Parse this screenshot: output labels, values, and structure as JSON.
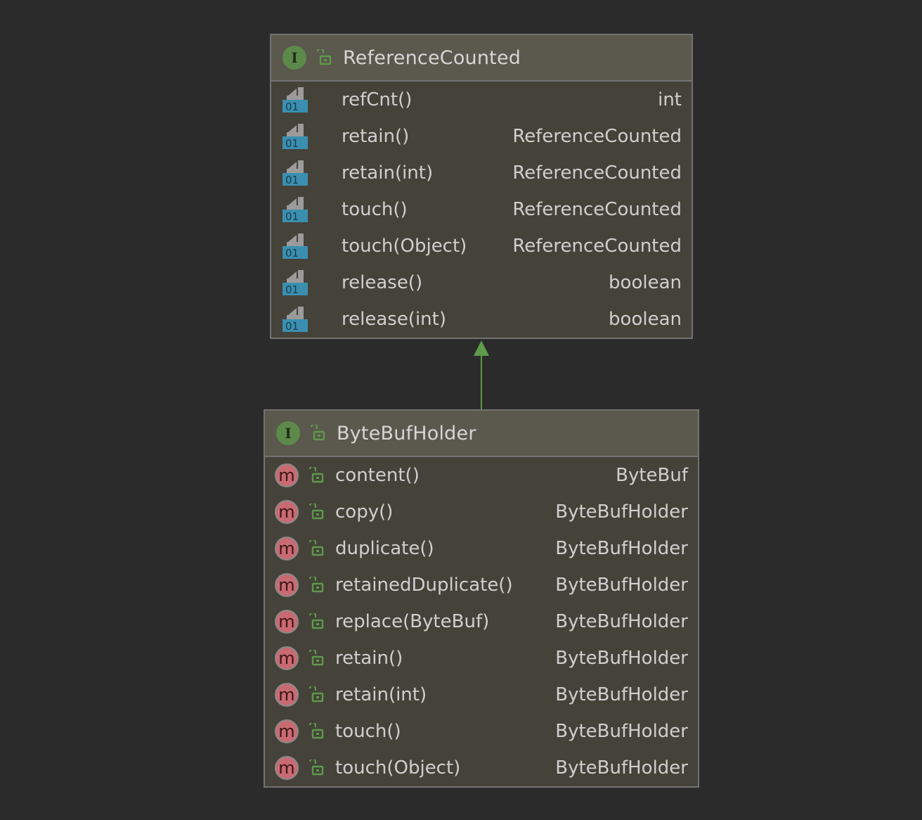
{
  "colors": {
    "background": "#2b2b2b",
    "box_fill": "#45423a",
    "header_fill": "#5b584d",
    "border": "#727272",
    "interface_badge": "#5d8a4a",
    "method_icon": "#c96a72",
    "lock": "#5d9a4a",
    "abstract_icon_blue": "#3a8fb0",
    "arrow": "#5d9a4a"
  },
  "reference_counted": {
    "badge": "I",
    "title": "ReferenceCounted",
    "header_icons": [
      "interface-icon",
      "public-lock-icon"
    ],
    "row_icon": "abstract-method-icon",
    "row_icon_text": "01",
    "methods": [
      {
        "name": "refCnt()",
        "type": "int"
      },
      {
        "name": "retain()",
        "type": "ReferenceCounted"
      },
      {
        "name": "retain(int)",
        "type": "ReferenceCounted"
      },
      {
        "name": "touch()",
        "type": "ReferenceCounted"
      },
      {
        "name": "touch(Object)",
        "type": "ReferenceCounted"
      },
      {
        "name": "release()",
        "type": "boolean"
      },
      {
        "name": "release(int)",
        "type": "boolean"
      }
    ]
  },
  "byte_buf_holder": {
    "badge": "I",
    "title": "ByteBufHolder",
    "header_icons": [
      "interface-icon",
      "public-lock-icon"
    ],
    "row_icon": "method-icon",
    "row_icon_text": "m",
    "methods": [
      {
        "name": "content()",
        "type": "ByteBuf"
      },
      {
        "name": "copy()",
        "type": "ByteBufHolder"
      },
      {
        "name": "duplicate()",
        "type": "ByteBufHolder"
      },
      {
        "name": "retainedDuplicate()",
        "type": "ByteBufHolder"
      },
      {
        "name": "replace(ByteBuf)",
        "type": "ByteBufHolder"
      },
      {
        "name": "retain()",
        "type": "ByteBufHolder"
      },
      {
        "name": "retain(int)",
        "type": "ByteBufHolder"
      },
      {
        "name": "touch()",
        "type": "ByteBufHolder"
      },
      {
        "name": "touch(Object)",
        "type": "ByteBufHolder"
      }
    ]
  },
  "relationship": {
    "type": "extends",
    "from": "ByteBufHolder",
    "to": "ReferenceCounted"
  }
}
